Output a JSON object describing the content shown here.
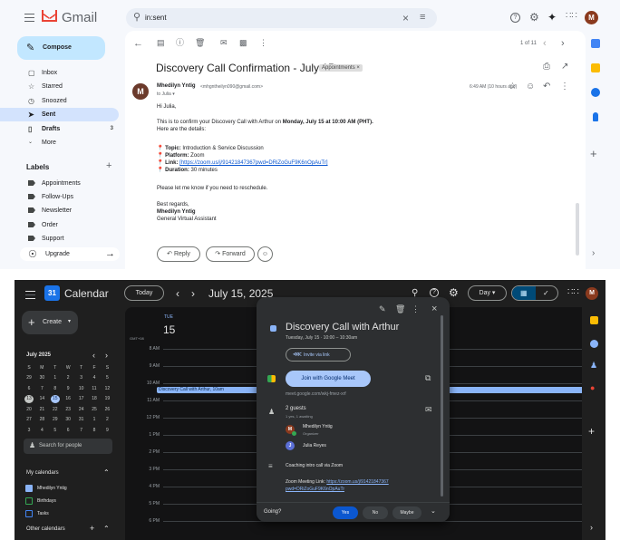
{
  "gmail": {
    "brand": "Gmail",
    "search": {
      "value": "in:sent"
    },
    "compose_label": "Compose",
    "nav": [
      {
        "label": "Inbox",
        "icon": "inbox-icon"
      },
      {
        "label": "Starred",
        "icon": "star-icon"
      },
      {
        "label": "Snoozed",
        "icon": "clock-icon"
      },
      {
        "label": "Sent",
        "icon": "send-icon",
        "selected": true
      },
      {
        "label": "Drafts",
        "icon": "draft-icon",
        "count": "3"
      },
      {
        "label": "More",
        "icon": "chevron-down-icon"
      }
    ],
    "labels_title": "Labels",
    "labels": [
      "Appointments",
      "Follow-Ups",
      "Newsletter",
      "Order",
      "Support"
    ],
    "upgrade_label": "Upgrade",
    "pager": "1 of 11",
    "message": {
      "subject": "Discovery Call Confirmation - July 15",
      "tag": "Appointments",
      "sender_name": "Mhedilyn Yntig",
      "sender_email": "<mhgntheilyn090@gmail.com>",
      "to": "to Julia",
      "time": "6:49 AM (10 hours ago)",
      "greeting": "Hi Julia,",
      "intro_1": "This is to confirm your Discovery Call with Arthur on ",
      "intro_bold": "Monday, July 15 at 10:00 AM (PHT).",
      "intro_2": "Here are the details:",
      "details": [
        {
          "key": "Topic:",
          "value": "Introduction & Service Discussion"
        },
        {
          "key": "Platform:",
          "value": "Zoom"
        },
        {
          "key": "Link:",
          "value": "[https://zoom.us/j/91421847367pwd=DRiZoGuF9K6nOpAuTr]",
          "is_link": true
        },
        {
          "key": "Duration:",
          "value": "30 minutes"
        }
      ],
      "reschedule": "Please let me know if you need to reschedule.",
      "regards": "Best regards,",
      "sig_name": "Mhedilyn Yntig",
      "sig_title": "General Virtual Assistant"
    },
    "reply_label": "Reply",
    "forward_label": "Forward",
    "avatar_letter": "M"
  },
  "calendar": {
    "brand": "Calendar",
    "today_label": "Today",
    "date_title": "July 15, 2025",
    "view_label": "Day",
    "create_label": "Create",
    "mini_month": "July 2025",
    "weekdays": [
      "S",
      "M",
      "T",
      "W",
      "T",
      "F",
      "S"
    ],
    "weeks": [
      [
        "29",
        "30",
        "1",
        "2",
        "3",
        "4",
        "5"
      ],
      [
        "6",
        "7",
        "8",
        "9",
        "10",
        "11",
        "12"
      ],
      [
        "13",
        "14",
        "15",
        "16",
        "17",
        "18",
        "19"
      ],
      [
        "20",
        "21",
        "22",
        "23",
        "24",
        "25",
        "26"
      ],
      [
        "27",
        "28",
        "29",
        "30",
        "31",
        "1",
        "2"
      ],
      [
        "3",
        "4",
        "5",
        "6",
        "7",
        "8",
        "9"
      ]
    ],
    "search_people": "Search for people",
    "my_calendars": "My calendars",
    "calendars": [
      "Mhedilyn Yntig",
      "Birthdays",
      "Tasks"
    ],
    "other_calendars": "Other calendars",
    "day_name": "TUE",
    "day_num": "15",
    "tz": "GMT+08",
    "hours": [
      "8 AM",
      "9 AM",
      "10 AM",
      "11 AM",
      "12 PM",
      "1 PM",
      "2 PM",
      "3 PM",
      "4 PM",
      "5 PM",
      "6 PM"
    ],
    "event_label": "Discovery Call with Arthur, 10am",
    "popup": {
      "title": "Discovery Call with Arthur",
      "when": "Tuesday, July 15  ·  10:00 – 10:30am",
      "invite_label": "Invite via link",
      "meet_label": "Join with Google Meet",
      "meet_url": "meet.google.com/wkj-fmez-xrf",
      "guests": "2 guests",
      "guests_sub": "1 yes, 1 awaiting",
      "guest_list": [
        {
          "name": "Mhedilyn Yntig",
          "role": "Organizer",
          "initial": "M"
        },
        {
          "name": "Julia Reyes",
          "role": "",
          "initial": "J"
        }
      ],
      "description": "Coaching intro call via Zoom",
      "zoom_prefix": "Zoom Meeting Link: ",
      "zoom_link_1": "https://zoom.us/j/91421847367",
      "zoom_link_2": "pwd=DRiZoGuF9K6nOpAuTr",
      "going": "Going?",
      "yes": "Yes",
      "no": "No",
      "maybe": "Maybe"
    },
    "avatar_letter": "M"
  }
}
